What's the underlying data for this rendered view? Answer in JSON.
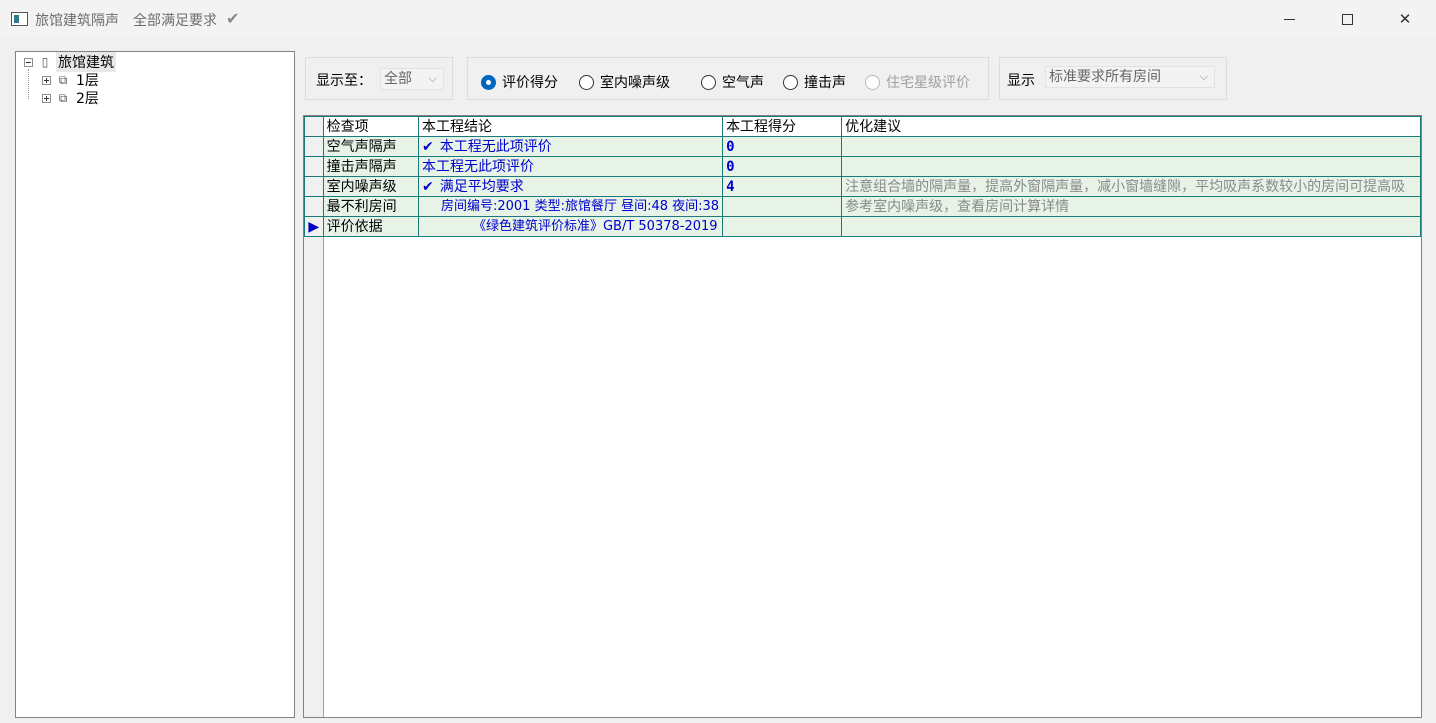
{
  "window": {
    "title": "旅馆建筑隔声",
    "status": "全部满足要求",
    "status_icon": "checkmark-icon",
    "minimize_icon": "minimize-icon",
    "maximize_icon": "maximize-icon",
    "close_icon": "close-icon",
    "close_glyph": "✕"
  },
  "tree": {
    "root": {
      "label": "旅馆建筑",
      "icon": "building-icon",
      "expanded": true
    },
    "children": [
      {
        "label": "1层",
        "icon": "floor-icon",
        "expanded": false
      },
      {
        "label": "2层",
        "icon": "floor-icon",
        "expanded": false
      }
    ]
  },
  "toolbar": {
    "show_to_label": "显示至：",
    "show_to_value": "全部",
    "radios": [
      {
        "label": "评价得分",
        "checked": true,
        "enabled": true
      },
      {
        "label": "室内噪声级",
        "checked": false,
        "enabled": true
      },
      {
        "label": "空气声",
        "checked": false,
        "enabled": true
      },
      {
        "label": "撞击声",
        "checked": false,
        "enabled": true
      },
      {
        "label": "住宅星级评价",
        "checked": false,
        "enabled": false
      }
    ],
    "display_label": "显示",
    "display_value": "标准要求所有房间",
    "chevron": "⌵"
  },
  "grid": {
    "columns": [
      "检查项",
      "本工程结论",
      "本工程得分",
      "优化建议"
    ],
    "current_row_marker": "▶",
    "check_glyph": "✔",
    "rows": [
      {
        "item": "空气声隔声",
        "conclusion": "本工程无此项评价",
        "check": true,
        "score": "0",
        "advice": ""
      },
      {
        "item": "撞击声隔声",
        "conclusion": "本工程无此项评价",
        "check": false,
        "score": "0",
        "advice": ""
      },
      {
        "item": "室内噪声级",
        "conclusion": "满足平均要求",
        "check": true,
        "score": "4",
        "advice": "注意组合墙的隔声量，提高外窗隔声量，减小窗墙缝隙，平均吸声系数较小的房间可提高吸"
      },
      {
        "item": "最不利房间",
        "conclusion": "房间编号:2001 类型:旅馆餐厅 昼间:48 夜间:38",
        "check": false,
        "score": "",
        "advice": "参考室内噪声级，查看房间计算详情"
      },
      {
        "item": "评价依据",
        "conclusion": "《绿色建筑评价标准》GB/T 50378-2019",
        "check": false,
        "score": "",
        "advice": "",
        "current": true
      }
    ]
  },
  "colors": {
    "grid_border": "#1b7b7b",
    "cell_bg": "#e6f3e6",
    "value_text": "#0000cc",
    "advice_text": "#8a8a8a",
    "radio_accent": "#0067c0"
  }
}
